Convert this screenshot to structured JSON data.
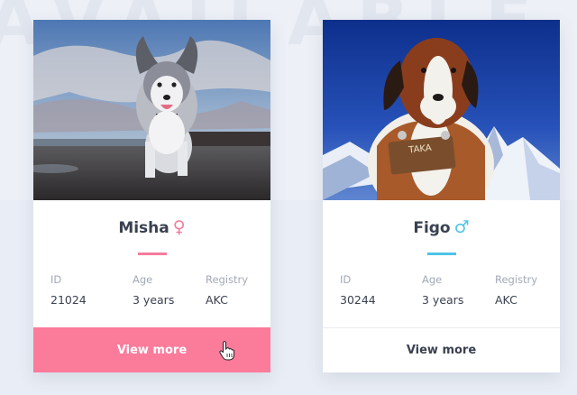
{
  "background": {
    "watermark": "AVAILABLE"
  },
  "cards": [
    {
      "name": "Misha",
      "sex_symbol": "♀",
      "accent": "#f47c9c",
      "labels": {
        "id": "ID",
        "age": "Age",
        "registry": "Registry"
      },
      "values": {
        "id": "21024",
        "age": "3 years",
        "registry": "AKC"
      },
      "button": "View more",
      "button_state": "hover"
    },
    {
      "name": "Figo",
      "sex_symbol": "♂",
      "accent": "#4fc3e8",
      "labels": {
        "id": "ID",
        "age": "Age",
        "registry": "Registry"
      },
      "values": {
        "id": "30244",
        "age": "3 years",
        "registry": "AKC"
      },
      "button": "View more",
      "button_state": "default",
      "photo_sign_text": "TAKA"
    }
  ],
  "colors": {
    "page_bg": "#e9edf5",
    "card_bg": "#ffffff",
    "primary_button": "#fb7b9b",
    "text_dark": "#3a4150",
    "text_muted": "#a3a9b7"
  }
}
